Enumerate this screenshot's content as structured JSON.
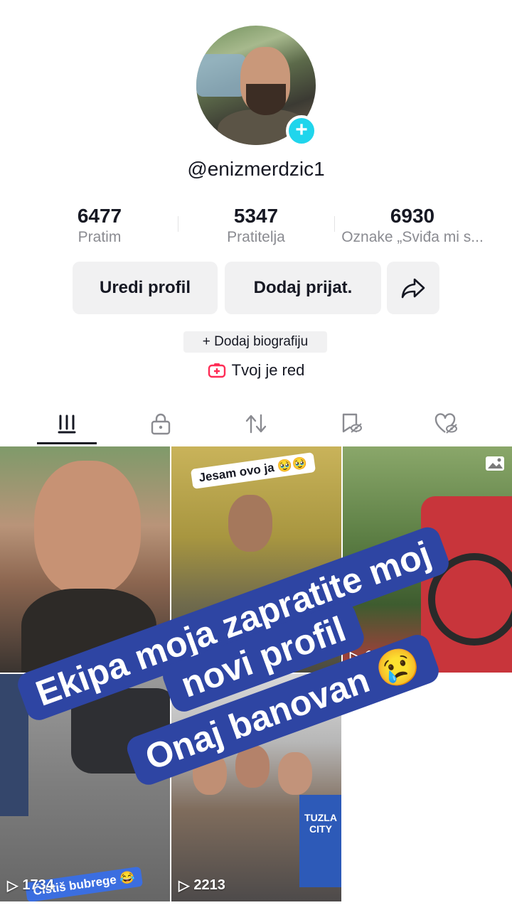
{
  "profile": {
    "username": "@enizmerdzic1",
    "stats": [
      {
        "value": "6477",
        "label": "Pratim"
      },
      {
        "value": "5347",
        "label": "Pratitelja"
      },
      {
        "value": "6930",
        "label": "Oznake „Sviđa mi s..."
      }
    ],
    "buttons": {
      "edit": "Uredi profil",
      "add_friends": "Dodaj prijat."
    },
    "bio_button": "+ Dodaj biografiju",
    "your_turn": "Tvoj je red"
  },
  "tabs": [
    {
      "icon": "grid-icon",
      "selected": true
    },
    {
      "icon": "lock-icon"
    },
    {
      "icon": "repost-icon"
    },
    {
      "icon": "favorites-icon"
    },
    {
      "icon": "liked-icon"
    }
  ],
  "videos": [
    {
      "views": ""
    },
    {
      "caption": "Jesam ovo ja 🥹🥹",
      "views": ""
    },
    {
      "views": "1381",
      "icon": "photo-icon"
    },
    {
      "views": "1734",
      "caption": "Čistiš bubrege 😂"
    },
    {
      "views": "2213",
      "caption": "TUZLA CITY"
    }
  ],
  "overlay_text": {
    "line1": "Ekipa moja zapratite moj",
    "line2": "novi profil",
    "line3": "Onaj banovan 😢"
  },
  "colors": {
    "overlay_bg": "#2e45a3",
    "accent_cyan": "#20d5ec",
    "accent_pink": "#fe2c55"
  }
}
